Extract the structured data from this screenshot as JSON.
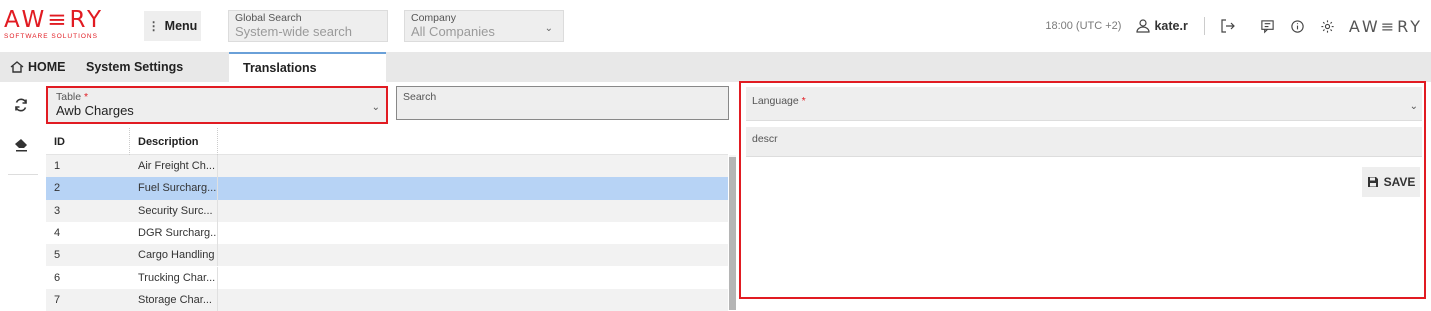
{
  "header": {
    "logo_text": "AW≡RY",
    "logo_subtext": "SOFTWARE SOLUTIONS",
    "menu_label": "Menu",
    "global_search": {
      "label": "Global Search",
      "placeholder": "System-wide search"
    },
    "company": {
      "label": "Company",
      "value": "All Companies"
    },
    "time": "18:00 (UTC +2)",
    "username": "kate.r",
    "right_logo_text": "AW≡RY"
  },
  "tabs": [
    {
      "label": "HOME"
    },
    {
      "label": "System Settings"
    },
    {
      "label": "Translations"
    }
  ],
  "left_panel": {
    "table_select": {
      "label": "Table",
      "required_mark": "*",
      "value": "Awb Charges"
    },
    "search": {
      "label": "Search"
    },
    "columns": [
      "ID",
      "Description"
    ],
    "rows": [
      {
        "id": "1",
        "description": "Air Freight Ch..."
      },
      {
        "id": "2",
        "description": "Fuel Surcharg..."
      },
      {
        "id": "3",
        "description": "Security Surc..."
      },
      {
        "id": "4",
        "description": "DGR Surcharg..."
      },
      {
        "id": "5",
        "description": "Cargo Handling"
      },
      {
        "id": "6",
        "description": "Trucking Char..."
      },
      {
        "id": "7",
        "description": "Storage Char..."
      }
    ],
    "selected_row_id": "2"
  },
  "right_panel": {
    "language": {
      "label": "Language",
      "required_mark": "*"
    },
    "descr_label": "descr",
    "save_label": "SAVE"
  },
  "colors": {
    "accent_red": "#e11b22",
    "selected_row": "#b7d3f5",
    "tab_active_border": "#6aa0d8"
  }
}
